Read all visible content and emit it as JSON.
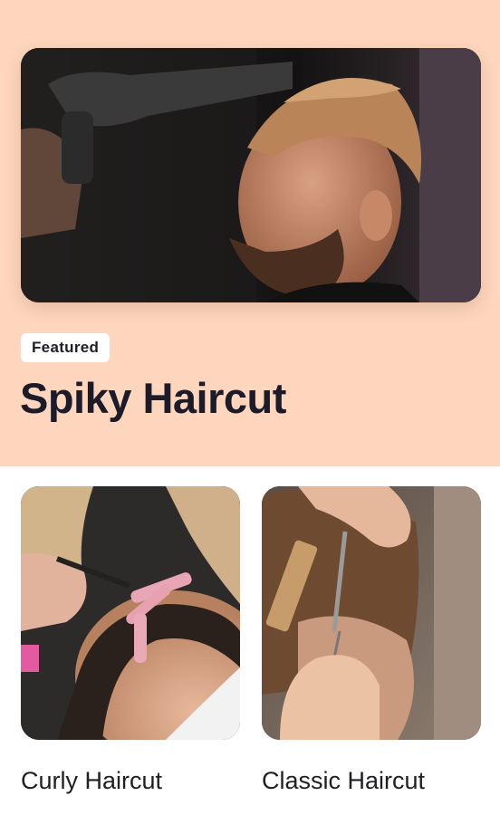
{
  "featured": {
    "badge": "Featured",
    "title": "Spiky Haircut",
    "image_alt": "barber blow-drying a man's spiky haircut"
  },
  "cards": [
    {
      "label": "Curly Haircut",
      "image_alt": "hair being set with clips and dye brush"
    },
    {
      "label": "Classic Haircut",
      "image_alt": "barber trimming hair with comb and scissors"
    }
  ],
  "colors": {
    "hero_background": "#fdd6bd",
    "badge_background": "#ffffff",
    "title_text": "#1b1b2a"
  }
}
